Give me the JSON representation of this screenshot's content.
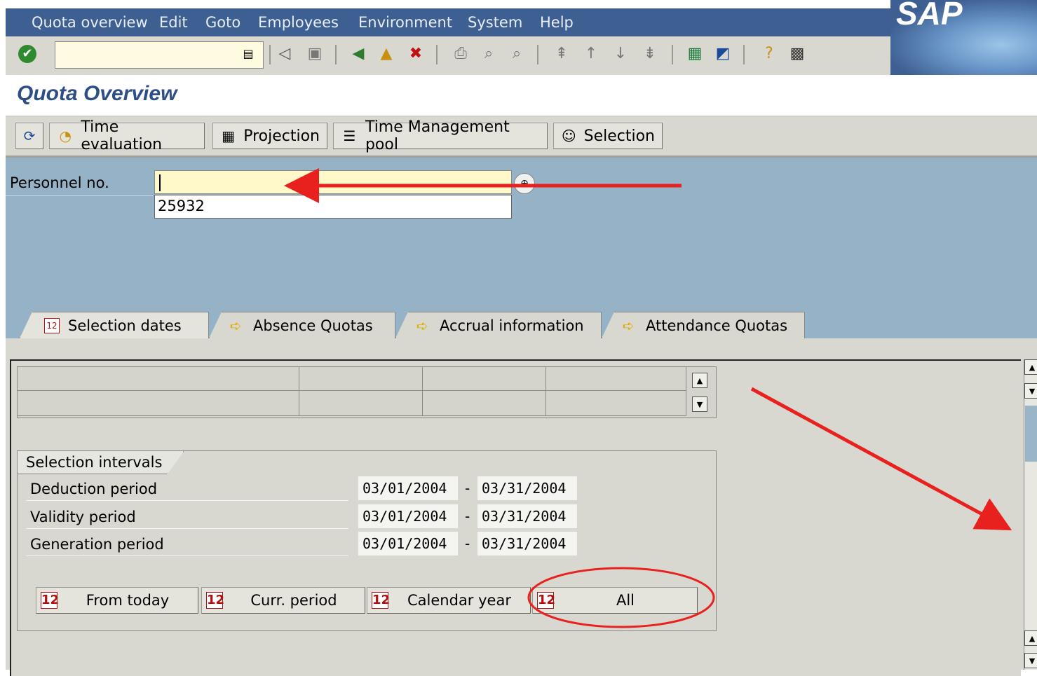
{
  "app": {
    "menu": [
      "Quota overview",
      "Edit",
      "Goto",
      "Employees",
      "Environment",
      "System",
      "Help"
    ],
    "logo": "SAP"
  },
  "title": "Quota Overview",
  "app_toolbar": {
    "time_evaluation": "Time evaluation",
    "projection": "Projection",
    "time_management_pool": "Time Management pool",
    "selection": "Selection"
  },
  "personnel": {
    "label": "Personnel no.",
    "value": "",
    "dropdown_value": "25932"
  },
  "tabs": [
    "Selection dates",
    "Absence Quotas",
    "Accrual information",
    "Attendance Quotas"
  ],
  "selection_intervals": {
    "title": "Selection intervals",
    "rows": [
      {
        "label": "Deduction period",
        "from": "03/01/2004",
        "to": "03/31/2004"
      },
      {
        "label": "Validity period",
        "from": "03/01/2004",
        "to": "03/31/2004"
      },
      {
        "label": "Generation period",
        "from": "03/01/2004",
        "to": "03/31/2004"
      }
    ],
    "separator": "-"
  },
  "buttons": {
    "from_today": "From today",
    "curr_period": "Curr. period",
    "calendar_year": "Calendar year",
    "all": "All"
  },
  "colors": {
    "menubar": "#3e5f92",
    "selection_area": "#95b2c6",
    "annotation": "#e8211e"
  }
}
